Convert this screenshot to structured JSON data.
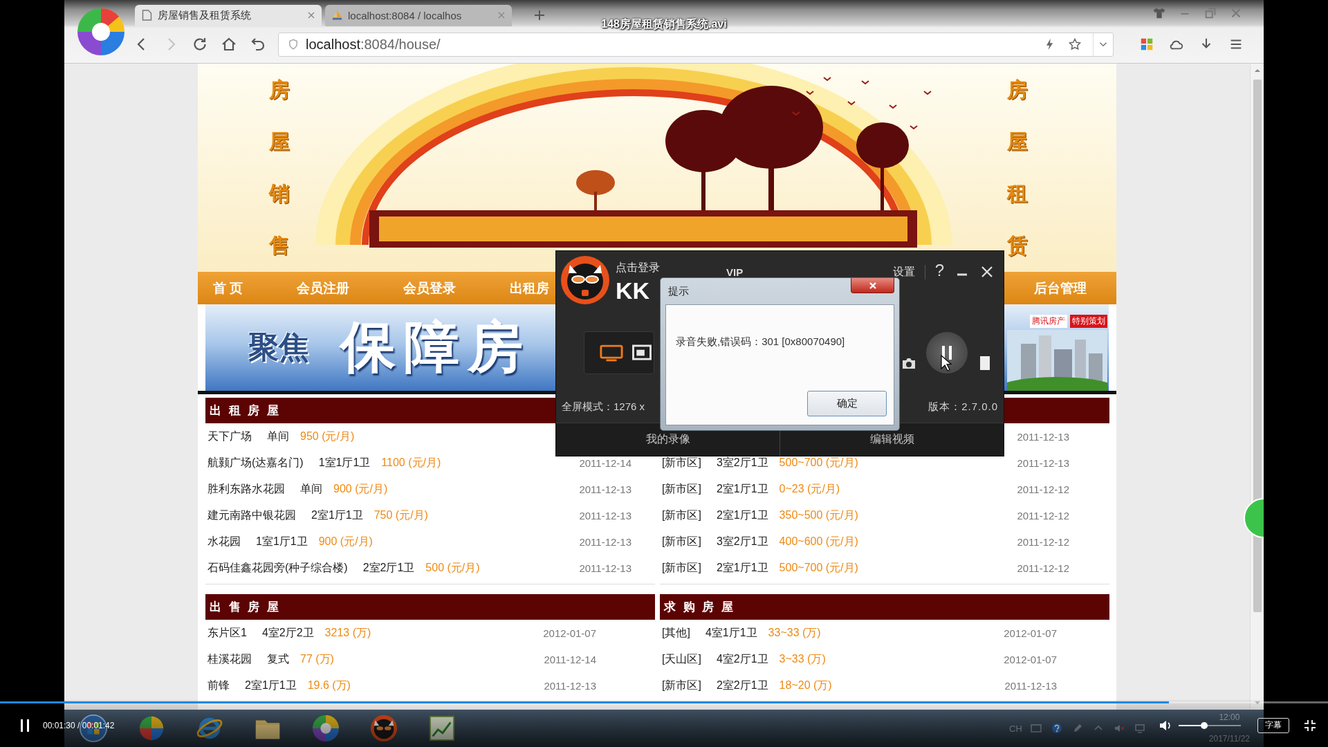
{
  "player": {
    "title": "148房屋租赁销售系统.avi",
    "playing": true,
    "time": "00:01:30 / 00:01:42",
    "progress": {
      "level": 0.88
    },
    "volume": {
      "level": 0.41
    },
    "subtitles": "字幕"
  },
  "browser": {
    "tabs": [
      {
        "title": "房屋销售及租赁系统",
        "kind": "page",
        "selected": true
      },
      {
        "title": "localhost:8084 / localhos",
        "kind": "sail",
        "selected": false
      }
    ],
    "forward_disabled": true,
    "url": {
      "host": "localhost",
      "path": ":8084/house/"
    }
  },
  "website": {
    "banner": {
      "left_text": "房屋销售",
      "right_text": "房屋租赁"
    },
    "nav": [
      "首 页",
      "会员注册",
      "会员登录",
      "出租房",
      "后台管理"
    ],
    "ad": {
      "kicker": "聚焦",
      "headline": "保障房",
      "tags": [
        {
          "label": "腾讯房产",
          "kind": "plain"
        },
        {
          "label": "特别策划",
          "kind": "solid"
        }
      ]
    },
    "sections": [
      {
        "title": "出 租 房 屋",
        "rows": [
          {
            "name": "天下广场",
            "layout": "单间",
            "price": "950 (元/月)"
          },
          {
            "name": "航颢广场(达嘉名门)",
            "layout": "1室1厅1卫",
            "price": "1100 (元/月)",
            "date": "2011-12-14"
          },
          {
            "name": "胜利东路水花园",
            "layout": "单间",
            "price": "900 (元/月)",
            "date": "2011-12-13"
          },
          {
            "name": "建元南路中银花园",
            "layout": "2室1厅1卫",
            "price": "750 (元/月)",
            "date": "2011-12-13"
          },
          {
            "name": "水花园",
            "layout": "1室1厅1卫",
            "price": "900 (元/月)",
            "date": "2011-12-13"
          },
          {
            "name": "石码佳鑫花园旁(种子综合楼)",
            "layout": "2室2厅1卫",
            "price": "500 (元/月)",
            "date": "2011-12-13"
          }
        ]
      },
      {
        "rows": [
          {
            "date": "2011-12-13"
          },
          {
            "name": "[新市区]",
            "layout": "3室2厅1卫",
            "price": "500~700 (元/月)",
            "date": "2011-12-13"
          },
          {
            "name": "[新市区]",
            "layout": "2室1厅1卫",
            "price": "0~23 (元/月)",
            "date": "2011-12-12"
          },
          {
            "name": "[新市区]",
            "layout": "2室1厅1卫",
            "price": "350~500 (元/月)",
            "date": "2011-12-12"
          },
          {
            "name": "[新市区]",
            "layout": "3室2厅1卫",
            "price": "400~600 (元/月)",
            "date": "2011-12-12"
          },
          {
            "name": "[新市区]",
            "layout": "2室1厅1卫",
            "price": "500~700 (元/月)",
            "date": "2011-12-12"
          }
        ]
      },
      {
        "title": "出 售 房 屋",
        "rows": [
          {
            "name": "东片区1",
            "layout": "4室2厅2卫",
            "price": "3213 (万)",
            "date": "2012-01-07"
          },
          {
            "name": "桂溪花园",
            "layout": "复式",
            "price": "77 (万)",
            "date": "2011-12-14"
          },
          {
            "name": "前锋",
            "layout": "2室1厅1卫",
            "price": "19.6 (万)",
            "date": "2011-12-13"
          }
        ]
      },
      {
        "title": "求 购 房 屋",
        "rows": [
          {
            "name": "[其他]",
            "layout": "4室1厅1卫",
            "price": "33~33 (万)",
            "date": "2012-01-07"
          },
          {
            "name": "[天山区]",
            "layout": "4室2厅1卫",
            "price": "3~33 (万)",
            "date": "2012-01-07"
          },
          {
            "name": "[新市区]",
            "layout": "2室2厅1卫",
            "price": "18~20 (万)",
            "date": "2011-12-13"
          }
        ]
      }
    ]
  },
  "recorder": {
    "login": "点击登录",
    "title": "KK",
    "vip": "VIP",
    "settings": "设置",
    "help": "?",
    "capture_modes": [
      {
        "kind": "screen",
        "selected": true
      },
      {
        "kind": "window",
        "selected": false
      }
    ],
    "mode_info": "全屏模式：1276 x",
    "version": "版本：2.7.0.0",
    "tabs": [
      "我的录像",
      "编辑视频"
    ],
    "dialog": {
      "title": "提示",
      "message": "录音失败,错误码：301 [0x80070490]",
      "button": "确定"
    }
  },
  "taskbar": {
    "language": "CH",
    "time": "12:00",
    "date": "2017/11/22"
  }
}
